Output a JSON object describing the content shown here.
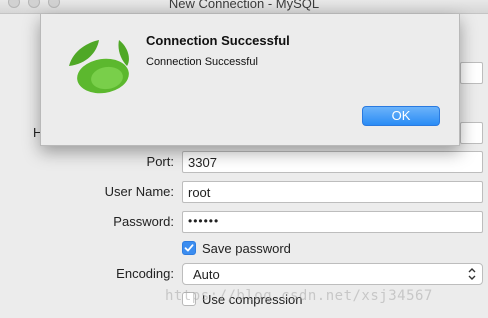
{
  "window": {
    "title": "New Connection - MySQL"
  },
  "form": {
    "host_label_partial": "H",
    "port_label": "Port:",
    "port_value": "3307",
    "user_label": "User Name:",
    "user_value": "root",
    "password_label": "Password:",
    "password_value": "••••••",
    "save_password_label": "Save password",
    "save_password_checked": true,
    "encoding_label": "Encoding:",
    "encoding_value": "Auto",
    "use_compression_label": "Use compression",
    "use_compression_checked": false
  },
  "alert": {
    "title": "Connection Successful",
    "message": "Connection Successful",
    "ok_label": "OK",
    "logo_icon": "navicat-leaf-icon"
  },
  "watermark": "https://blog.csdn.net/xsj34567",
  "colors": {
    "accent": "#2a8cf5",
    "logo_green": "#5cb82e"
  }
}
